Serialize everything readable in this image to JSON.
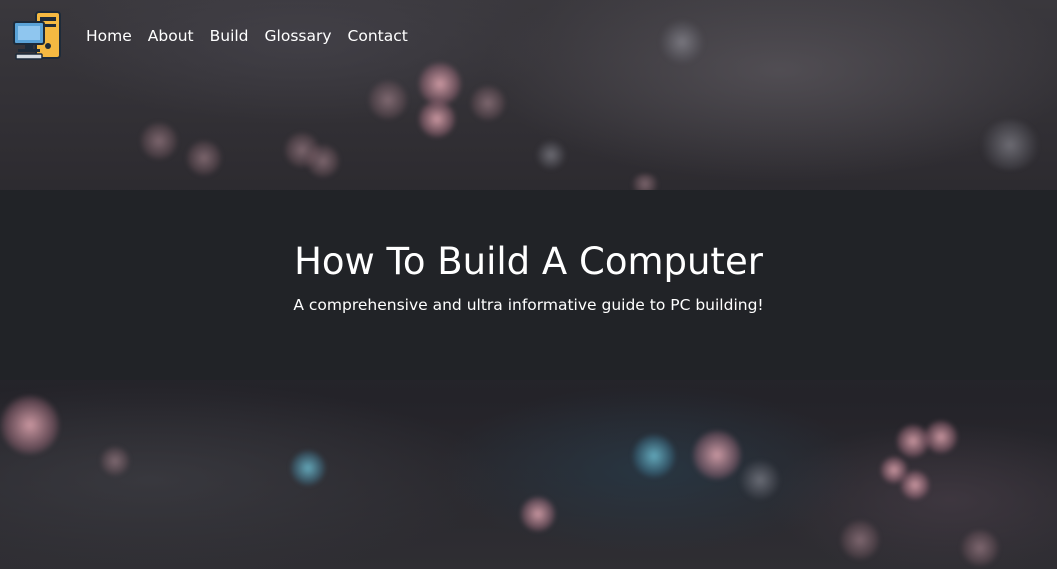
{
  "nav": {
    "logo_icon": "computer-logo-icon",
    "links": [
      {
        "label": "Home"
      },
      {
        "label": "About"
      },
      {
        "label": "Build"
      },
      {
        "label": "Glossary"
      },
      {
        "label": "Contact"
      }
    ]
  },
  "hero": {
    "title": "How To Build A Computer",
    "subtitle": "A comprehensive and ultra informative guide to PC building!"
  },
  "colors": {
    "hero_background": "#212327",
    "text": "#ffffff"
  }
}
